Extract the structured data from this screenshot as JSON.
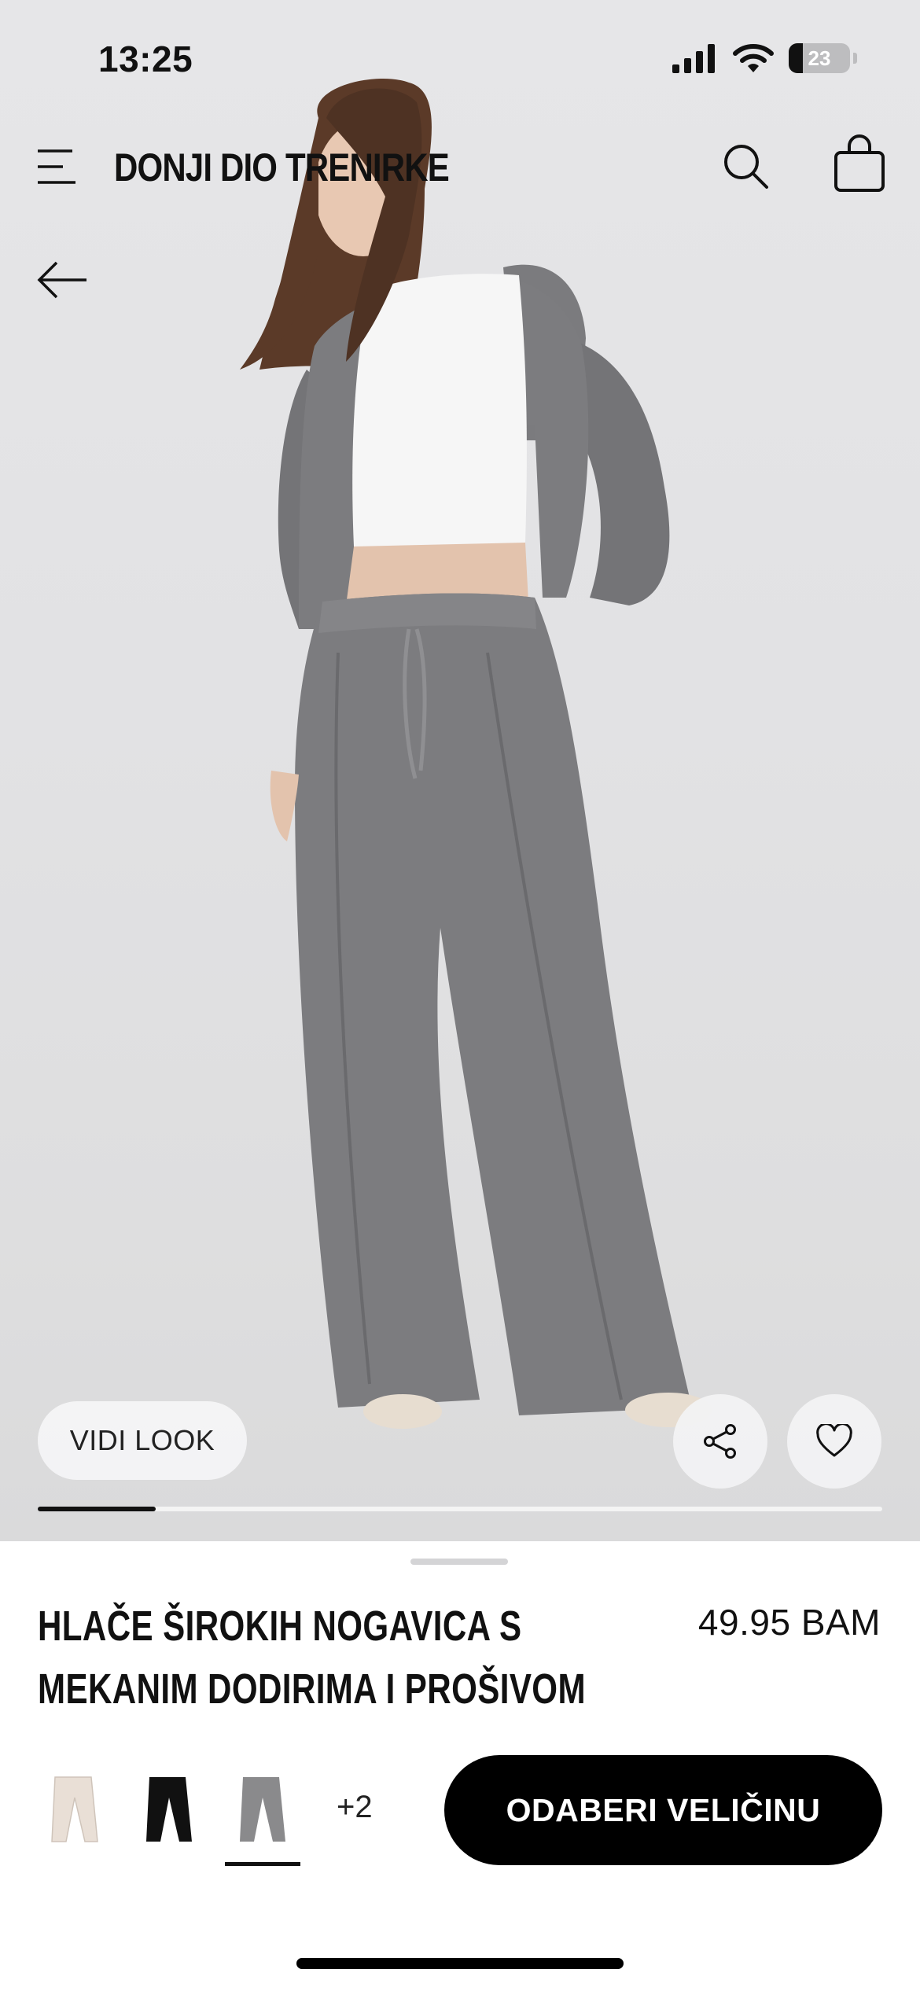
{
  "status_bar": {
    "time": "13:25",
    "battery": "23",
    "icons": [
      "cellular-signal-icon",
      "wifi-icon",
      "battery-icon"
    ]
  },
  "header": {
    "title": "DONJI DIO TRENIRKE",
    "icons": [
      "menu-icon",
      "search-icon",
      "shopping-bag-icon",
      "back-arrow-icon"
    ]
  },
  "gallery": {
    "look_label": "VIDI LOOK",
    "progress": 0.14,
    "icons": [
      "share-icon",
      "heart-icon"
    ]
  },
  "product": {
    "name": "HLAČE ŠIROKIH NOGAVICA S MEKANIM DODIRIMA I PROŠIVOM",
    "price": "49.95 BAM",
    "colors": [
      {
        "name": "bež",
        "hex": "#e9dfd6"
      },
      {
        "name": "crna",
        "hex": "#111111"
      },
      {
        "name": "siva",
        "hex": "#8a8a8c",
        "selected": true
      }
    ],
    "more_colors": "+2",
    "select_size": "ODABERI VELIČINU"
  },
  "colors": {
    "primary": "#000000",
    "background": "#ffffff",
    "garment_grey": "#7c7c7f"
  }
}
